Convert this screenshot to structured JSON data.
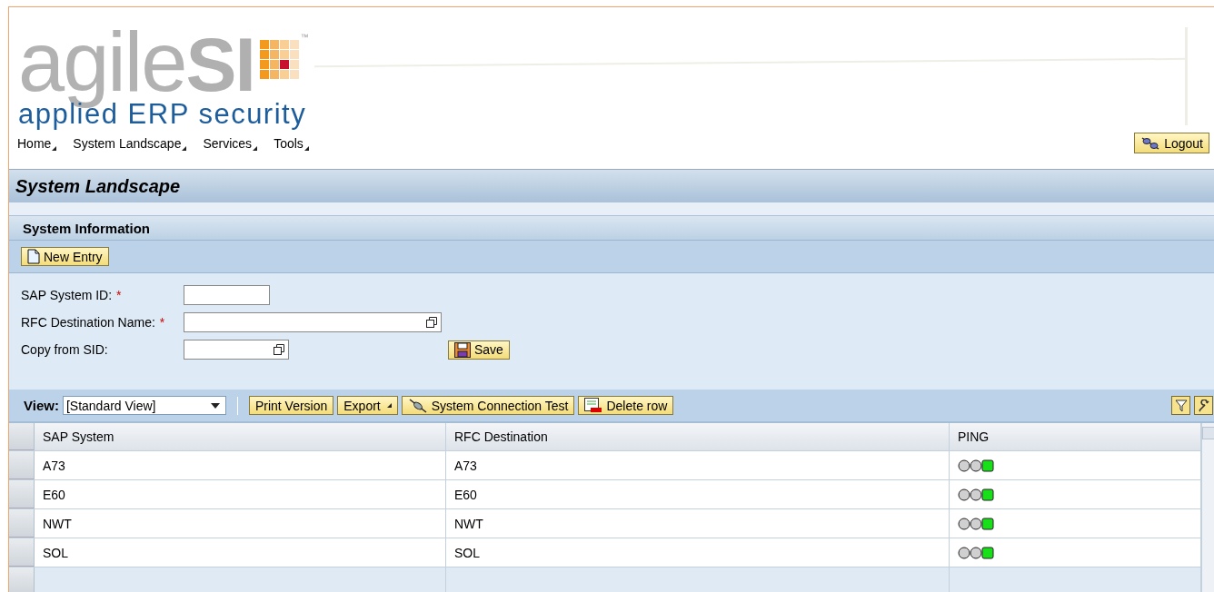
{
  "logo": {
    "word": "agile",
    "accent": "SI",
    "trademark": "™",
    "tagline": "applied ERP security"
  },
  "menu": [
    {
      "label": "Home"
    },
    {
      "label": "System Landscape"
    },
    {
      "label": "Services"
    },
    {
      "label": "Tools"
    }
  ],
  "logout": "Logout",
  "page_title": "System Landscape",
  "section": {
    "title": "System Information",
    "new_entry": "New Entry"
  },
  "form": {
    "fields": [
      {
        "label": "SAP System ID:",
        "required_marker": "*",
        "value_help": false
      },
      {
        "label": "RFC Destination Name:",
        "required_marker": "*",
        "value_help": true
      },
      {
        "label": "Copy from SID:",
        "value_help": true
      }
    ],
    "save": "Save"
  },
  "table_toolbar": {
    "view_label": "View:",
    "view_value": "[Standard View]",
    "print": "Print Version",
    "export": "Export",
    "connection_test": "System Connection Test",
    "delete_row": "Delete row"
  },
  "table": {
    "columns": [
      "SAP System",
      "RFC Destination",
      "PING"
    ],
    "rows": [
      {
        "sap_system": "A73",
        "rfc_destination": "A73",
        "color": "#18e018"
      },
      {
        "sap_system": "E60",
        "rfc_destination": "E60",
        "color": "#18e018"
      },
      {
        "sap_system": "NWT",
        "rfc_destination": "NWT",
        "color": "#18e018"
      },
      {
        "sap_system": "SOL",
        "rfc_destination": "SOL",
        "color": "#18e018"
      }
    ]
  }
}
